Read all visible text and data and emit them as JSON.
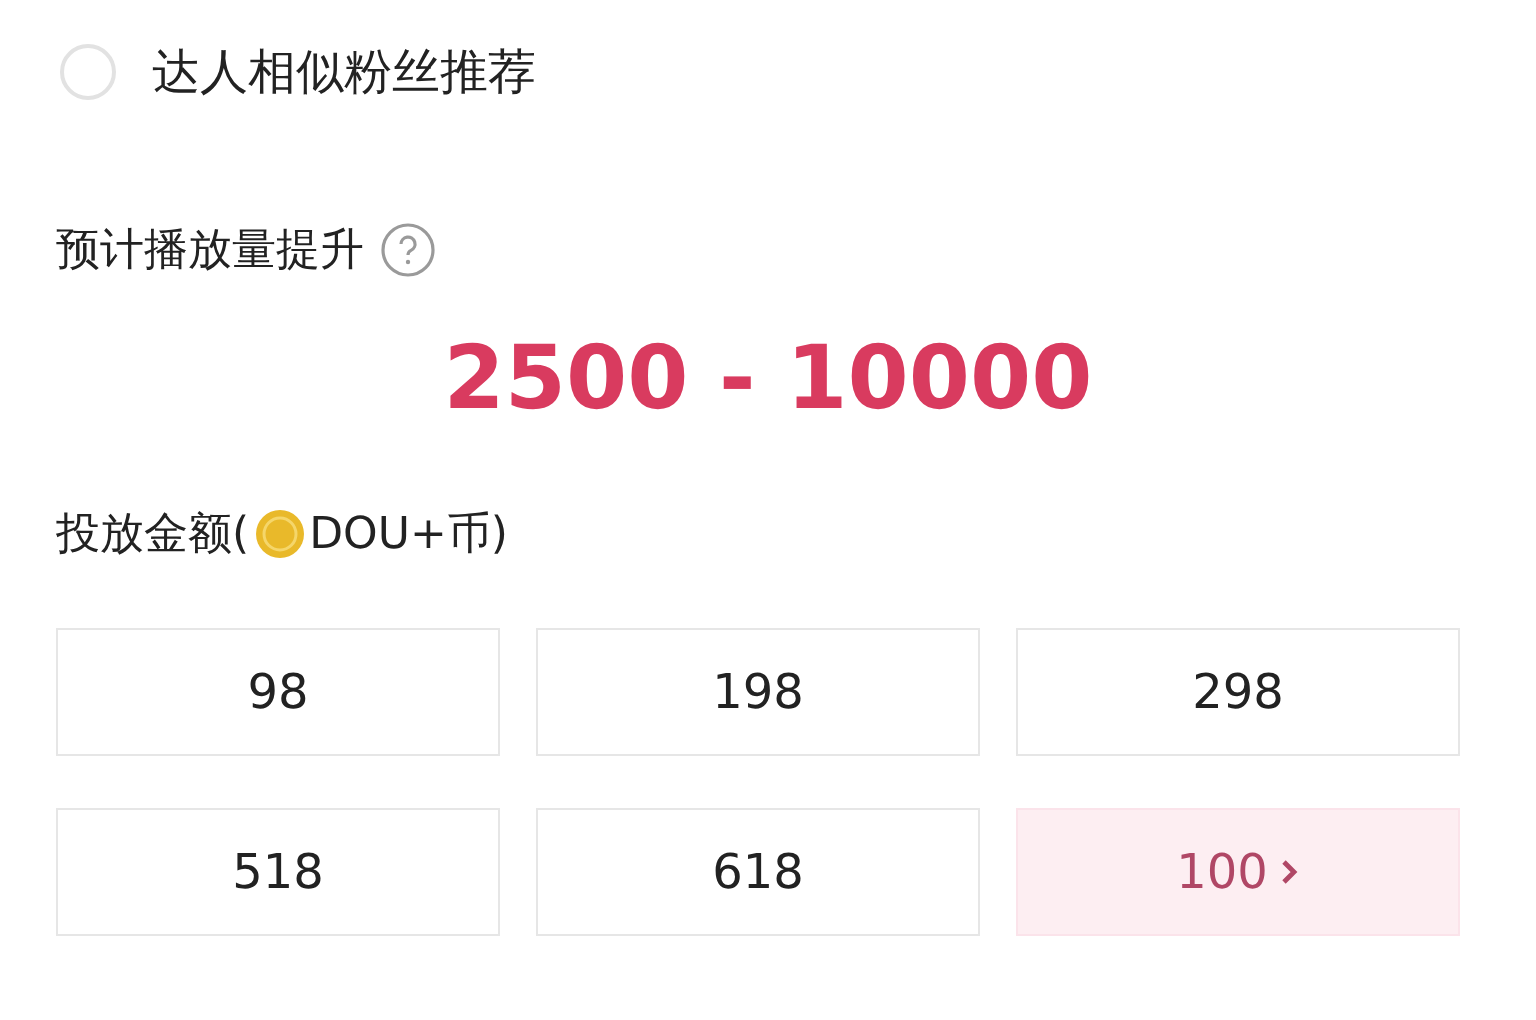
{
  "option": {
    "label": "达人相似粉丝推荐",
    "selected": false
  },
  "estimate": {
    "label": "预计播放量提升",
    "value": "2500 - 10000"
  },
  "amount": {
    "label_before": "投放金额(",
    "label_after": "DOU+币)"
  },
  "tiles": [
    {
      "label": "98",
      "kind": "preset",
      "selected": false
    },
    {
      "label": "198",
      "kind": "preset",
      "selected": false
    },
    {
      "label": "298",
      "kind": "preset",
      "selected": false
    },
    {
      "label": "518",
      "kind": "preset",
      "selected": false
    },
    {
      "label": "618",
      "kind": "preset",
      "selected": false
    },
    {
      "label": "100",
      "kind": "custom",
      "selected": true
    }
  ]
}
